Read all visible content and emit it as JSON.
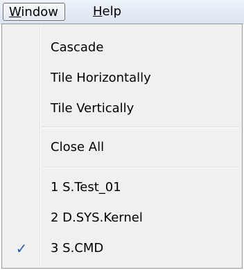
{
  "menubar": {
    "window": {
      "mnemonic": "W",
      "rest": "indow"
    },
    "help": {
      "mnemonic": "H",
      "rest": "elp"
    }
  },
  "window_menu": {
    "items": [
      {
        "label": "Cascade"
      },
      {
        "label": "Tile Horizontally"
      },
      {
        "label": "Tile Vertically"
      },
      {
        "label": "Close All"
      },
      {
        "label": "1 S.Test_01"
      },
      {
        "label": "2 D.SYS.Kernel"
      },
      {
        "label": "3 S.CMD",
        "checked": true
      }
    ],
    "check_glyph": "✓"
  },
  "colors": {
    "check": "#2a5a9a",
    "menu_background": "#f0f0f0"
  },
  "icons": {
    "check": "check-icon"
  }
}
